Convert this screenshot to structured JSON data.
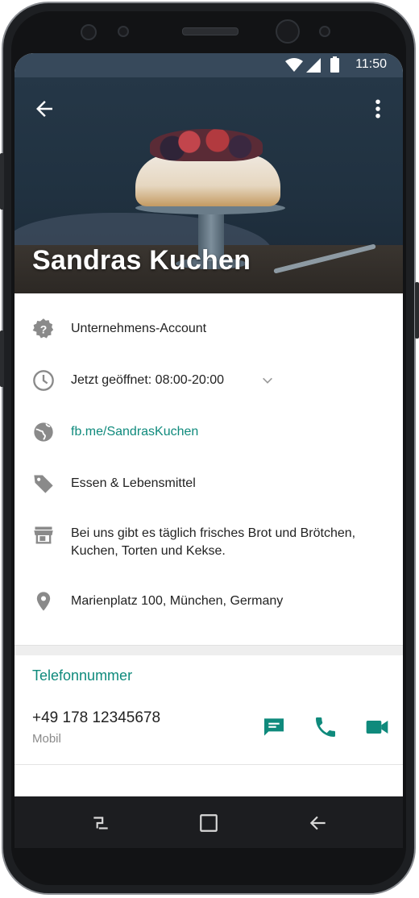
{
  "status_bar": {
    "time": "11:50"
  },
  "profile": {
    "name": "Sandras Kuchen"
  },
  "info_rows": {
    "account_type": "Unternehmens-Account",
    "hours": "Jetzt geöffnet: 08:00-20:00",
    "website": "fb.me/SandrasKuchen",
    "category": "Essen & Lebensmittel",
    "description": "Bei uns gibt es täglich frisches Brot und Brötchen, Kuchen, Torten und Kekse.",
    "address": "Marienplatz 100, München, Germany"
  },
  "phone_section": {
    "title": "Telefonnummer",
    "number": "+49 178 12345678",
    "type": "Mobil"
  },
  "icons": {
    "back": "arrow-left-icon",
    "more": "more-vert-icon",
    "account": "verified-badge-icon",
    "hours": "clock-icon",
    "website": "globe-icon",
    "category": "tag-icon",
    "description": "store-icon",
    "address": "location-pin-icon",
    "message": "message-icon",
    "call": "phone-icon",
    "video": "video-icon"
  },
  "colors": {
    "accent": "#0f8a7c",
    "statusbar": "#37495b"
  }
}
